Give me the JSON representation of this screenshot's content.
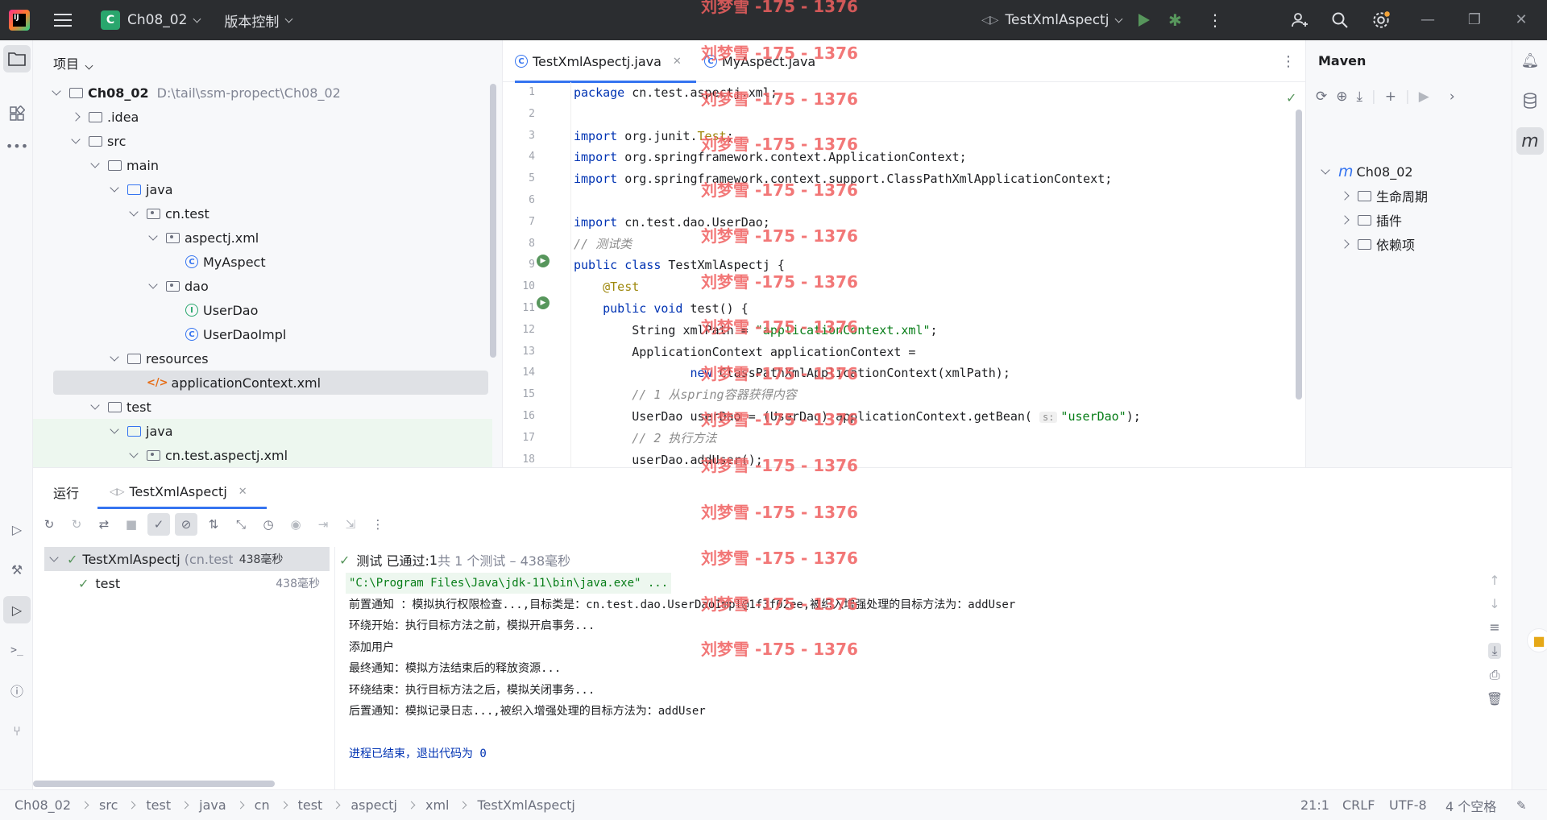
{
  "titlebar": {
    "project_badge": "C",
    "project_name": "Ch08_02",
    "vcs_label": "版本控制",
    "run_config": "TestXmlAspectj"
  },
  "project_panel": {
    "title": "项目",
    "tree": [
      {
        "label": "Ch08_02",
        "extra": "D:\\tail\\ssm-propect\\Ch08_02",
        "indent": 0,
        "chev": "down",
        "icon": "module-folder",
        "bold": true
      },
      {
        "label": ".idea",
        "indent": 1,
        "chev": "right",
        "icon": "folder"
      },
      {
        "label": "src",
        "indent": 1,
        "chev": "down",
        "icon": "folder"
      },
      {
        "label": "main",
        "indent": 2,
        "chev": "down",
        "icon": "folder"
      },
      {
        "label": "java",
        "indent": 3,
        "chev": "down",
        "icon": "folder-blue"
      },
      {
        "label": "cn.test",
        "indent": 4,
        "chev": "down",
        "icon": "package"
      },
      {
        "label": "aspectj.xml",
        "indent": 5,
        "chev": "down",
        "icon": "package"
      },
      {
        "label": "MyAspect",
        "indent": 6,
        "chev": "none",
        "icon": "class"
      },
      {
        "label": "dao",
        "indent": 5,
        "chev": "down",
        "icon": "package"
      },
      {
        "label": "UserDao",
        "indent": 6,
        "chev": "none",
        "icon": "interface"
      },
      {
        "label": "UserDaoImpl",
        "indent": 6,
        "chev": "none",
        "icon": "class"
      },
      {
        "label": "resources",
        "indent": 3,
        "chev": "down",
        "icon": "folder-res"
      },
      {
        "label": "applicationContext.xml",
        "indent": 4,
        "chev": "none",
        "icon": "xml",
        "selected": true
      },
      {
        "label": "test",
        "indent": 2,
        "chev": "down",
        "icon": "folder"
      },
      {
        "label": "java",
        "indent": 3,
        "chev": "down",
        "icon": "folder-blue",
        "green": true
      },
      {
        "label": "cn.test.aspectj.xml",
        "indent": 4,
        "chev": "down",
        "icon": "package",
        "green": true
      }
    ]
  },
  "editor": {
    "tabs": [
      {
        "label": "TestXmlAspectj.java",
        "active": true
      },
      {
        "label": "MyAspect.java",
        "active": false
      }
    ],
    "line_numbers": [
      "1",
      "2",
      "3",
      "4",
      "5",
      "6",
      "7",
      "8",
      "9",
      "10",
      "11",
      "12",
      "13",
      "14",
      "15",
      "16",
      "17",
      "18"
    ],
    "lines": [
      [
        {
          "t": "package",
          "c": "kw"
        },
        {
          "t": " cn.test.aspectj.xml;"
        }
      ],
      [],
      [
        {
          "t": "import",
          "c": "kw"
        },
        {
          "t": " org.junit."
        },
        {
          "t": "Test",
          "c": "ann"
        },
        {
          "t": ";"
        }
      ],
      [
        {
          "t": "import",
          "c": "kw"
        },
        {
          "t": " org.springframework.context.ApplicationContext;"
        }
      ],
      [
        {
          "t": "import",
          "c": "kw"
        },
        {
          "t": " org.springframework.context.support.ClassPathXmlApplicationContext;"
        }
      ],
      [],
      [
        {
          "t": "import",
          "c": "kw"
        },
        {
          "t": " cn.test.dao.UserDao;"
        }
      ],
      [
        {
          "t": "// 测试类",
          "c": "cmt"
        }
      ],
      [
        {
          "t": "public class",
          "c": "kw"
        },
        {
          "t": " TestXmlAspectj {"
        }
      ],
      [
        {
          "t": "    "
        },
        {
          "t": "@Test",
          "c": "ann"
        }
      ],
      [
        {
          "t": "    "
        },
        {
          "t": "public void",
          "c": "kw"
        },
        {
          "t": " test() {"
        }
      ],
      [
        {
          "t": "        String xmlPath = "
        },
        {
          "t": "\"applicationContext.xml\"",
          "c": "str"
        },
        {
          "t": ";"
        }
      ],
      [
        {
          "t": "        ApplicationContext applicationContext ="
        }
      ],
      [
        {
          "t": "                "
        },
        {
          "t": "new",
          "c": "kw"
        },
        {
          "t": " ClassPathXmlApplicationContext(xmlPath);"
        }
      ],
      [
        {
          "t": "        "
        },
        {
          "t": "// 1 从spring容器获得内容",
          "c": "cmt"
        }
      ],
      [
        {
          "t": "        UserDao userDao = (UserDao) applicationContext.getBean( "
        },
        {
          "t": "s:",
          "c": "hint"
        },
        {
          "t": "\"userDao\"",
          "c": "str"
        },
        {
          "t": ");"
        }
      ],
      [
        {
          "t": "        "
        },
        {
          "t": "// 2 执行方法",
          "c": "cmt"
        }
      ],
      [
        {
          "t": "        userDao.addUser();"
        }
      ]
    ]
  },
  "maven": {
    "title": "Maven",
    "root": "Ch08_02",
    "items": [
      "生命周期",
      "插件",
      "依赖项"
    ]
  },
  "run_panel": {
    "title": "运行",
    "tab_label": "TestXmlAspectj",
    "status_prefix": "测试 已通过: ",
    "status_count": "1",
    "status_suffix": "共 1 个测试 – 438毫秒",
    "results": [
      {
        "name": "TestXmlAspectj",
        "detail": "(cn.test.asp",
        "time": "438毫秒"
      },
      {
        "name": "test",
        "detail": "",
        "time": "438毫秒"
      }
    ],
    "console": [
      "\"C:\\Program Files\\Java\\jdk-11\\bin\\java.exe\" ...",
      "前置通知 ：模拟执行权限检查...,目标类是：cn.test.dao.UserDaoImpl@1f3f02ee,被织入增强处理的目标方法为：addUser",
      "环绕开始：执行目标方法之前，模拟开启事务...",
      "添加用户",
      "最终通知：模拟方法结束后的释放资源...",
      "环绕结束：执行目标方法之后，模拟关闭事务...",
      "后置通知：模拟记录日志...,被织入增强处理的目标方法为：addUser",
      "",
      "进程已结束，退出代码为 0"
    ]
  },
  "statusbar": {
    "breadcrumb": [
      "Ch08_02",
      "src",
      "test",
      "java",
      "cn",
      "test",
      "aspectj",
      "xml",
      "TestXmlAspectj"
    ],
    "position": "21:1",
    "line_sep": "CRLF",
    "encoding": "UTF-8",
    "indent": "4 个空格"
  },
  "watermark": "刘梦雪 -175 - 1376",
  "colors": {
    "accent": "#3574f0",
    "success": "#57965c",
    "titlebar": "#2b2d30",
    "watermark": "#f06060"
  }
}
